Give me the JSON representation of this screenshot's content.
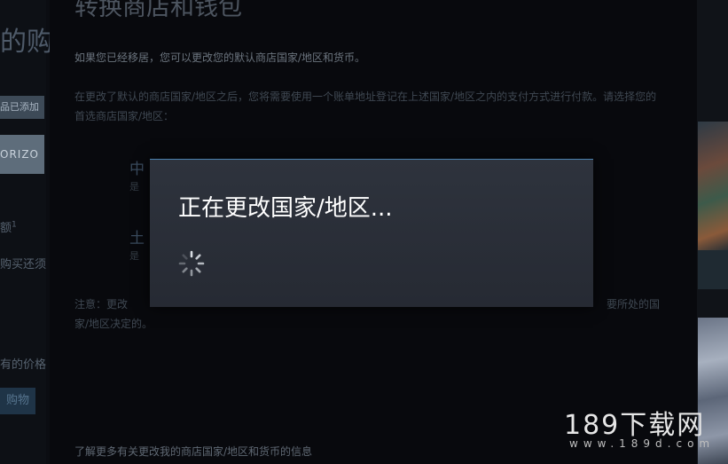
{
  "sidebar": {
    "title": "的购",
    "badge": "品已添加",
    "thumbnail_text": "ORIZO",
    "text_1": "额",
    "text_1_sup": "1",
    "text_2": "购买还须",
    "text_3": "有的价格",
    "button_label": "购物"
  },
  "page": {
    "title": "转换商店和钱包",
    "intro": "如果您已经移居，您可以更改您的默认商店国家/地区和货币。",
    "paragraph": "在更改了默认的商店国家/地区之后，您将需要使用一个账单地址登记在上述国家/地区之内的支付方式进行付款。请选择您的首选商店国家/地区：",
    "options": [
      {
        "title": "中",
        "subtitle": "是"
      },
      {
        "title": "土",
        "subtitle": "是"
      }
    ],
    "note_line1": "注意：更改",
    "note_line1_end": "要所处的国",
    "note_line2": "家/地区决定的。",
    "footer_link": "了解更多有关更改我的商店国家/地区和货币的信息"
  },
  "modal": {
    "title": "正在更改国家/地区...",
    "spinner_icon": "loading-spinner-icon"
  },
  "watermark": {
    "main": "189下载网",
    "sub": "www.189d.com"
  },
  "colors": {
    "background": "#0b0d12",
    "modal_bg": "#2b2f38",
    "modal_accent": "#4a80ad",
    "modal_text": "#ffffff"
  }
}
